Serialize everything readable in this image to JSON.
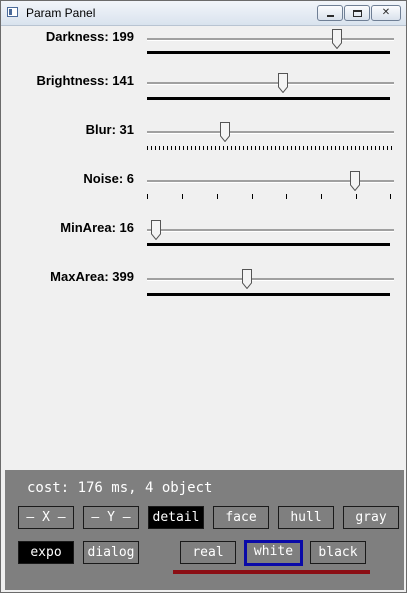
{
  "window": {
    "title": "Param Panel"
  },
  "sliders": [
    {
      "label": "Darkness: 199",
      "value": 199,
      "max": 255,
      "indicator": "line"
    },
    {
      "label": "Brightness: 141",
      "value": 141,
      "max": 255,
      "indicator": "line"
    },
    {
      "label": "Blur: 31",
      "value": 31,
      "max": 100,
      "indicator": "dense-ticks"
    },
    {
      "label": "Noise: 6",
      "value": 6,
      "max": 7,
      "indicator": "ticks"
    },
    {
      "label": "MinArea: 16",
      "value": 16,
      "max": 1000,
      "indicator": "line"
    },
    {
      "label": "MaxArea: 399",
      "value": 399,
      "max": 1000,
      "indicator": "line"
    }
  ],
  "status": {
    "text": "cost: 176 ms, 4 object"
  },
  "buttons": {
    "x": "— X —",
    "y": "— Y —",
    "detail": "detail",
    "face": "face",
    "hull": "hull",
    "gray": "gray",
    "expo": "expo",
    "dialog": "dialog",
    "real": "real",
    "white": "white",
    "black": "black"
  },
  "colors": {
    "panel_bg": "#f0f0f0",
    "bottom_bg": "#7f7f7f",
    "selected_border": "#0a0aa8",
    "group_underline": "#8b0e14"
  }
}
